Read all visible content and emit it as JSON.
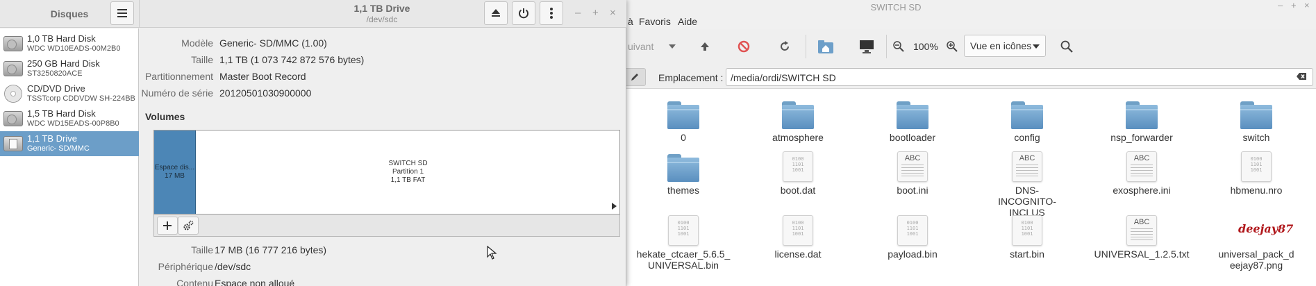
{
  "file_manager": {
    "title": "SWITCH SD",
    "window_controls": [
      "–",
      "+",
      "×"
    ],
    "menus": [
      "à",
      "Favoris",
      "Aide"
    ],
    "toolbar": {
      "forward_label": "uivant",
      "zoom_level": "100%",
      "view_mode": "Vue en icônes"
    },
    "location": {
      "label": "Emplacement :",
      "path": "/media/ordi/SWITCH SD"
    },
    "items": [
      {
        "name": "0",
        "type": "folder"
      },
      {
        "name": "atmosphere",
        "type": "folder"
      },
      {
        "name": "bootloader",
        "type": "folder"
      },
      {
        "name": "config",
        "type": "folder"
      },
      {
        "name": "nsp_forwarder",
        "type": "folder"
      },
      {
        "name": "switch",
        "type": "folder"
      },
      {
        "name": "themes",
        "type": "folder"
      },
      {
        "name": "boot.dat",
        "type": "binary"
      },
      {
        "name": "boot.ini",
        "type": "text"
      },
      {
        "name": "DNS-INCOGNITO-INCLUS",
        "type": "text"
      },
      {
        "name": "exosphere.ini",
        "type": "text"
      },
      {
        "name": "hbmenu.nro",
        "type": "binary"
      },
      {
        "name": "hekate_ctcaer_5.6.5_UNIVERSAL.bin",
        "type": "binary"
      },
      {
        "name": "license.dat",
        "type": "binary"
      },
      {
        "name": "payload.bin",
        "type": "binary"
      },
      {
        "name": "start.bin",
        "type": "binary"
      },
      {
        "name": "UNIVERSAL_1.2.5.txt",
        "type": "text"
      },
      {
        "name": "universal_pack_deejay87.png",
        "type": "image"
      }
    ],
    "binary_glyph": "0100\n1101\n1001",
    "text_glyph": "ABC",
    "png_thumb_text": "deejay87"
  },
  "disks": {
    "sidebar_title": "Disques",
    "header_title": "1,1 TB Drive",
    "header_subtitle": "/dev/sdc",
    "window_controls": [
      "–",
      "+",
      "×"
    ],
    "drives": [
      {
        "name": "1,0 TB Hard Disk",
        "model": "WDC WD10EADS-00M2B0",
        "icon": "hard-disk-icon",
        "selected": false
      },
      {
        "name": "250 GB Hard Disk",
        "model": "ST3250820ACE",
        "icon": "hard-disk-icon",
        "selected": false
      },
      {
        "name": "CD/DVD Drive",
        "model": "TSSTcorp CDDVDW SH-224BB",
        "icon": "optical-disc-icon",
        "selected": false
      },
      {
        "name": "1,5 TB Hard Disk",
        "model": "WDC WD15EADS-00P8B0",
        "icon": "hard-disk-icon",
        "selected": false
      },
      {
        "name": "1,1 TB Drive",
        "model": "Generic- SD/MMC",
        "icon": "sd-card-icon",
        "selected": true
      }
    ],
    "details": [
      {
        "label": "Modèle",
        "value": "Generic- SD/MMC (1.00)"
      },
      {
        "label": "Taille",
        "value": "1,1 TB (1 073 742 872 576 bytes)"
      },
      {
        "label": "Partitionnement",
        "value": "Master Boot Record"
      },
      {
        "label": "Numéro de série",
        "value": "20120501030900000"
      }
    ],
    "volumes_heading": "Volumes",
    "partitions": [
      {
        "line1": "Espace dis...",
        "line2": "17 MB",
        "line3": ""
      },
      {
        "line1": "SWITCH SD",
        "line2": "Partition 1",
        "line3": "1,1 TB FAT"
      }
    ],
    "selected_details": [
      {
        "label": "Taille",
        "value": "17 MB (16 777 216 bytes)"
      },
      {
        "label": "Périphérique",
        "value": "/dev/sdc"
      },
      {
        "label": "Contenu",
        "value": "Espace non alloué"
      }
    ],
    "colors": {
      "selection": "#6c9ec8",
      "partition_free": "#4c86b6"
    }
  }
}
